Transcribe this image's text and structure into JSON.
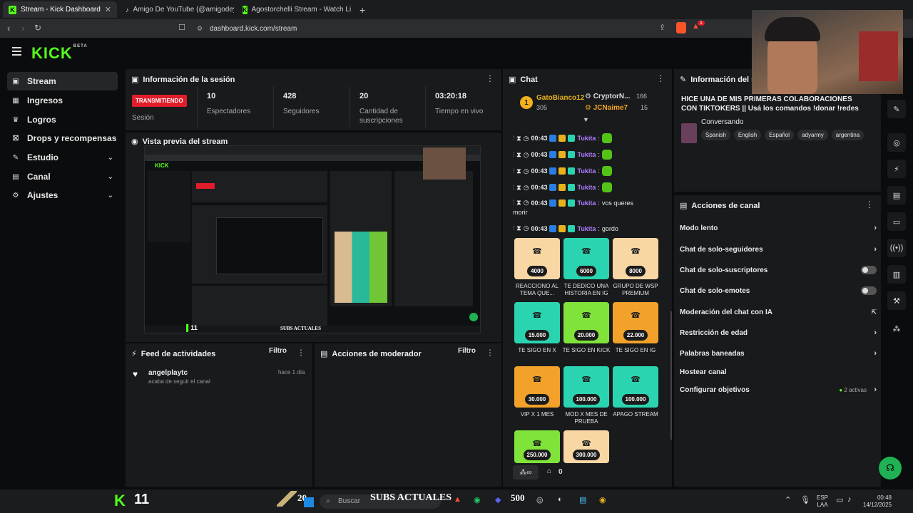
{
  "browser": {
    "tabs": [
      {
        "title": "Stream - Kick Dashboard",
        "active": true
      },
      {
        "title": "Amigo De YouTube (@amigodeyout",
        "active": false
      },
      {
        "title": "Agostorchelli Stream - Watch Live",
        "active": false
      }
    ],
    "url": "dashboard.kick.com/stream",
    "badge_count": "1"
  },
  "app": {
    "logo": "KICK",
    "logo_sup": "BETA"
  },
  "sidebar": {
    "items": [
      {
        "label": "Stream",
        "icon": "video-icon",
        "active": true,
        "expandable": false
      },
      {
        "label": "Ingresos",
        "icon": "grid-icon",
        "active": false,
        "expandable": false
      },
      {
        "label": "Logros",
        "icon": "trophy-icon",
        "active": false,
        "expandable": false
      },
      {
        "label": "Drops y recompensas",
        "icon": "gift-icon",
        "active": false,
        "expandable": false
      },
      {
        "label": "Estudio",
        "icon": "pencil-icon",
        "active": false,
        "expandable": true
      },
      {
        "label": "Canal",
        "icon": "channel-icon",
        "active": false,
        "expandable": true
      },
      {
        "label": "Ajustes",
        "icon": "gear-icon",
        "active": false,
        "expandable": true
      }
    ]
  },
  "session": {
    "title": "Información de la sesión",
    "status": "TRANSMITIENDO",
    "status_label": "Sesión",
    "stats": [
      {
        "value": "10",
        "label": "Espectadores"
      },
      {
        "value": "428",
        "label": "Seguidores"
      },
      {
        "value": "20",
        "label": "Cantidad de suscripciones"
      },
      {
        "value": "03:20:18",
        "label": "Tiempo en vivo"
      }
    ]
  },
  "preview": {
    "title": "Vista previa del stream",
    "overlay_count": "11",
    "overlay_text": "SUBS ACTUALES"
  },
  "activity": {
    "title": "Feed de actividades",
    "filter": "Filtro",
    "items": [
      {
        "user": "angelplaytc",
        "text": "acaba de seguir el canal",
        "time": "hace 1 día"
      }
    ]
  },
  "moderator": {
    "title": "Acciones de moderador",
    "filter": "Filtro"
  },
  "chat": {
    "title": "Chat",
    "leaderboard": {
      "first": {
        "rank": "1",
        "user": "GatoBianco12",
        "value": "305"
      },
      "others": [
        {
          "user": "CryptorN...",
          "value": "166"
        },
        {
          "user": "JCNaime7",
          "value": "15"
        }
      ]
    },
    "messages": [
      {
        "time": "00:43",
        "user": "Tukita",
        "text": ""
      },
      {
        "time": "00:43",
        "user": "Tukita",
        "text": ""
      },
      {
        "time": "00:43",
        "user": "Tukita",
        "text": ""
      },
      {
        "time": "00:43",
        "user": "Tukita",
        "text": ""
      },
      {
        "time": "00:43",
        "user": "Tukita",
        "text": "vos queres"
      },
      {
        "time": "00:43",
        "user": "Tukita",
        "text": "gordo"
      }
    ],
    "wrap_text": "morir",
    "goals": [
      {
        "amount": "4000",
        "label": "REACCIONO AL TEMA QUE...",
        "color": "#f9d7a4"
      },
      {
        "amount": "6000",
        "label": "TE DEDICO UNA HISTORIA EN IG",
        "color": "#2bd4b0"
      },
      {
        "amount": "8000",
        "label": "GRUPO DE WSP PREMIUM",
        "color": "#f9d7a4"
      },
      {
        "amount": "15.000",
        "label": "TE SIGO EN X",
        "color": "#2bd4b0"
      },
      {
        "amount": "20.000",
        "label": "TE SIGO EN KICK",
        "color": "#7fe33a"
      },
      {
        "amount": "22.000",
        "label": "TE SIGO EN IG",
        "color": "#f2a12a"
      },
      {
        "amount": "30.000",
        "label": "VIP X 1 MES",
        "color": "#f2a12a"
      },
      {
        "amount": "100.000",
        "label": "MOD X MES DE PRUEBA",
        "color": "#2bd4b0"
      },
      {
        "amount": "100.000",
        "label": "APAGO STREAM",
        "color": "#2bd4b0"
      },
      {
        "amount": "250.000",
        "label": "",
        "color": "#7fe33a"
      },
      {
        "amount": "300.000",
        "label": "",
        "color": "#f9d7a4"
      }
    ],
    "footer_count": "0"
  },
  "stream_info": {
    "title": "Información del stre",
    "stream_title": "HICE UNA DE MIS PRIMERAS COLABORACIONES CON TIKTOKERS || Usá los comandos !donar !redes",
    "category": "Conversando",
    "tags": [
      "Spanish",
      "English",
      "Español",
      "adyarmy",
      "argentina"
    ]
  },
  "channel_actions": {
    "title": "Acciones de canal",
    "items": [
      {
        "label": "Modo lento",
        "type": "chevron"
      },
      {
        "label": "Chat de solo-seguidores",
        "type": "chevron"
      },
      {
        "label": "Chat de solo-suscriptores",
        "type": "toggle"
      },
      {
        "label": "Chat de solo-emotes",
        "type": "toggle"
      },
      {
        "label": "Moderación del chat con IA",
        "type": "external"
      },
      {
        "label": "Restricción de edad",
        "type": "chevron"
      },
      {
        "label": "Palabras baneadas",
        "type": "chevron"
      },
      {
        "label": "Hostear canal",
        "type": "none"
      },
      {
        "label": "Configurar objetivos",
        "type": "chevron",
        "extra": "2 activas"
      }
    ]
  },
  "taskbar": {
    "left_count": "11",
    "search": "Buscar",
    "subs_label": "SUBS ACTUALES",
    "num_a": "20",
    "num_b": "500",
    "lang": "ESP",
    "lang2": "LAA",
    "time": "00:48",
    "date": "14/12/2025"
  },
  "colors": {
    "accent": "#53fc18",
    "live": "#e11d2a",
    "panel": "#181a1c"
  }
}
